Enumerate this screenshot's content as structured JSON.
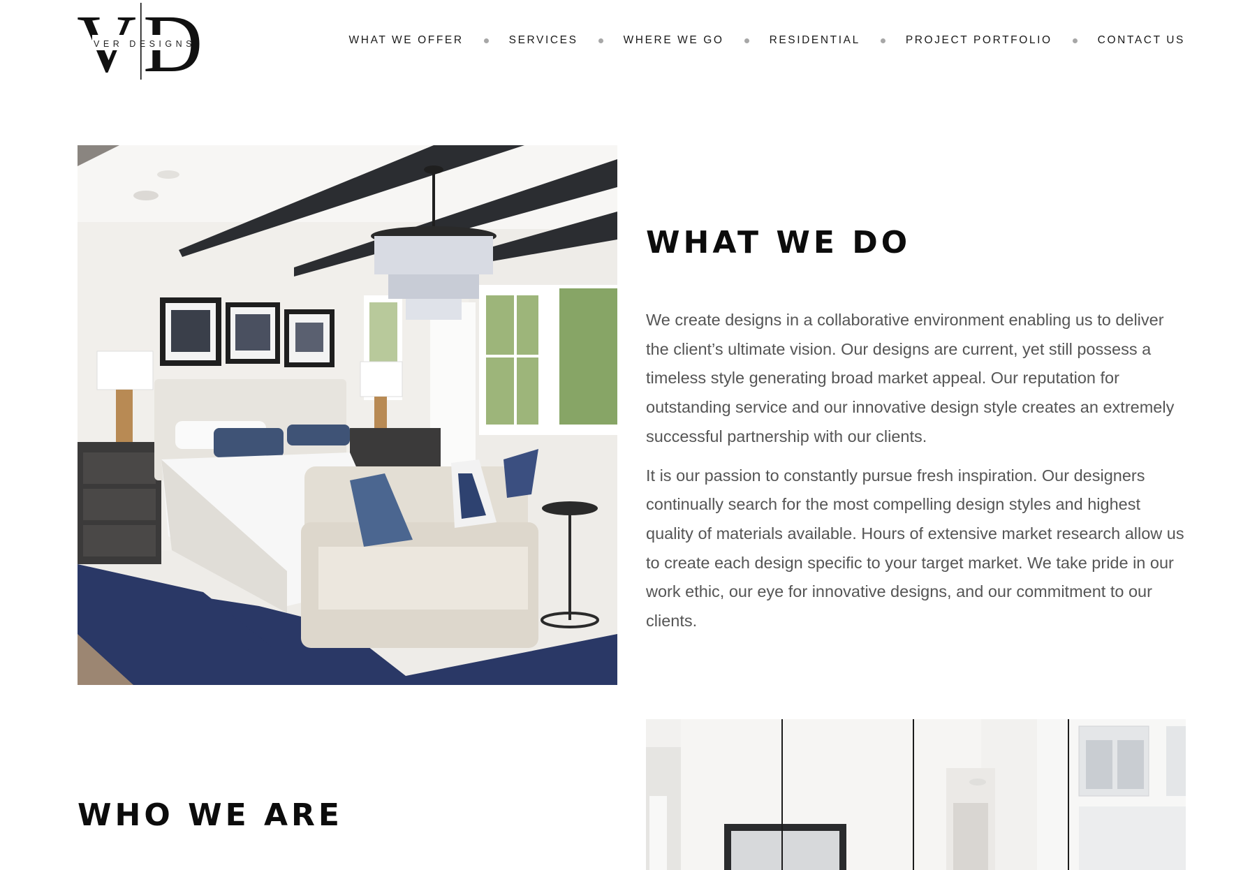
{
  "brand": {
    "monogram_left": "V",
    "monogram_right": "D",
    "tagline": "VER DESIGNS"
  },
  "nav": {
    "items": [
      {
        "label": "WHAT WE OFFER"
      },
      {
        "label": "SERVICES"
      },
      {
        "label": "WHERE WE GO"
      },
      {
        "label": "RESIDENTIAL"
      },
      {
        "label": "PROJECT PORTFOLIO"
      },
      {
        "label": "CONTACT US"
      }
    ]
  },
  "what_we_do": {
    "heading": "WHAT WE DO",
    "paragraphs": [
      "We create designs in a collaborative environment enabling us to deliver the client’s ultimate vision. Our designs are current, yet still possess a timeless style generating broad market appeal. Our reputation for outstanding service and our innovative design style creates an extremely successful partnership with our clients.",
      "It is our passion to constantly pursue fresh inspiration. Our designers continually search for the most compelling design styles and highest quality of materials available. Hours of extensive market research allow us to create each design specific to your target market. We take pride in our work ethic, our eye for innovative designs, and our commitment to our clients."
    ]
  },
  "who_we_are": {
    "heading": "WHO WE ARE"
  },
  "colors": {
    "text_dark": "#0c0c0c",
    "body_text": "#555555",
    "nav_dot": "#a7a7a7",
    "rug_navy": "#2a3866",
    "beam": "#2b2d31"
  }
}
